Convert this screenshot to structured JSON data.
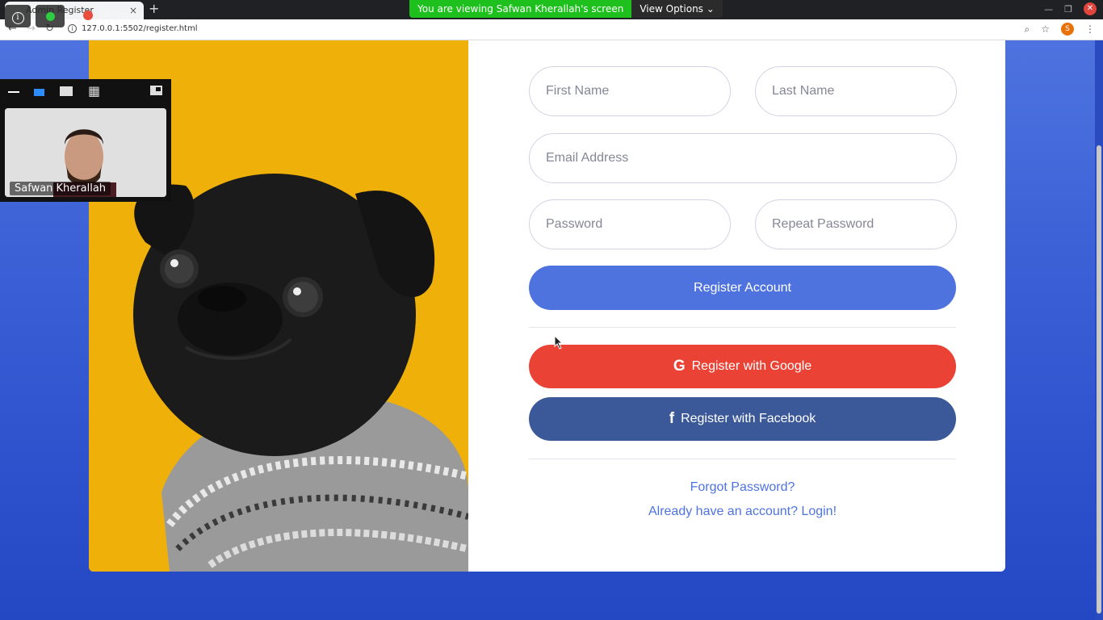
{
  "browser": {
    "tab_title": "Admin Register",
    "tab_close": "×",
    "new_tab": "+",
    "url": "127.0.0.1:5502/register.html",
    "recording_label": "Recording"
  },
  "share_banner": {
    "viewing_text": "You are viewing Safwan Kherallah's screen",
    "view_options_label": "View Options"
  },
  "video": {
    "participant_name": "Safwan Kherallah"
  },
  "form": {
    "first_name_placeholder": "First Name",
    "last_name_placeholder": "Last Name",
    "email_placeholder": "Email Address",
    "password_placeholder": "Password",
    "repeat_password_placeholder": "Repeat Password",
    "register_button": "Register Account",
    "google_button": "Register with Google",
    "facebook_button": "Register with Facebook",
    "forgot_password_link": "Forgot Password?",
    "login_link": "Already have an account? Login!"
  },
  "profile_initial": "S",
  "colors": {
    "primary": "#4e73df",
    "google": "#ea4335",
    "facebook": "#3b5998",
    "image_background": "#efb009"
  }
}
